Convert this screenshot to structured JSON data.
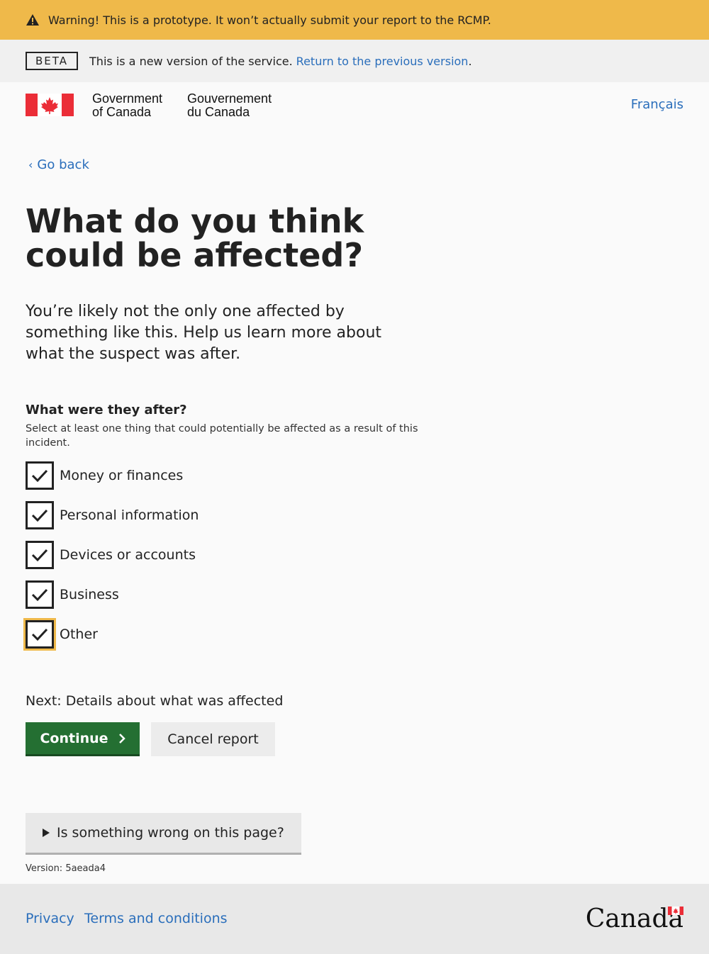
{
  "warning": {
    "icon": "warning-triangle-icon",
    "text": "Warning! This is a prototype. It won’t actually submit your report to the RCMP."
  },
  "beta": {
    "tag": "BETA",
    "text": "This is a new version of the service.",
    "link": "Return to the previous version",
    "period": "."
  },
  "header": {
    "gov_en_line1": "Government",
    "gov_en_line2": "of Canada",
    "gov_fr_line1": "Gouvernement",
    "gov_fr_line2": "du Canada",
    "language_link": "Français",
    "flag_red": "#eb2d37"
  },
  "nav": {
    "back": "Go back"
  },
  "main": {
    "title": "What do you think could be affected?",
    "lede": "You’re likely not the only one affected by something like this. Help us learn more about what the suspect was after.",
    "question": "What were they after?",
    "hint": "Select at least one thing that could potentially be affected as a result of this incident.",
    "options": [
      {
        "label": "Money or finances",
        "checked": true
      },
      {
        "label": "Personal information",
        "checked": true
      },
      {
        "label": "Devices or accounts",
        "checked": true
      },
      {
        "label": "Business",
        "checked": true
      },
      {
        "label": "Other",
        "checked": true,
        "focused": true
      }
    ],
    "next": "Next: Details about what was affected",
    "continue": "Continue",
    "cancel": "Cancel report"
  },
  "feedback": {
    "summary": "Is something wrong on this page?"
  },
  "version": "Version: 5aeada4",
  "footer": {
    "privacy": "Privacy",
    "terms": "Terms and conditions",
    "wordmark": "Canada"
  },
  "colors": {
    "warning": "#efb94a",
    "link": "#2a6ebb",
    "continue": "#246f32"
  }
}
